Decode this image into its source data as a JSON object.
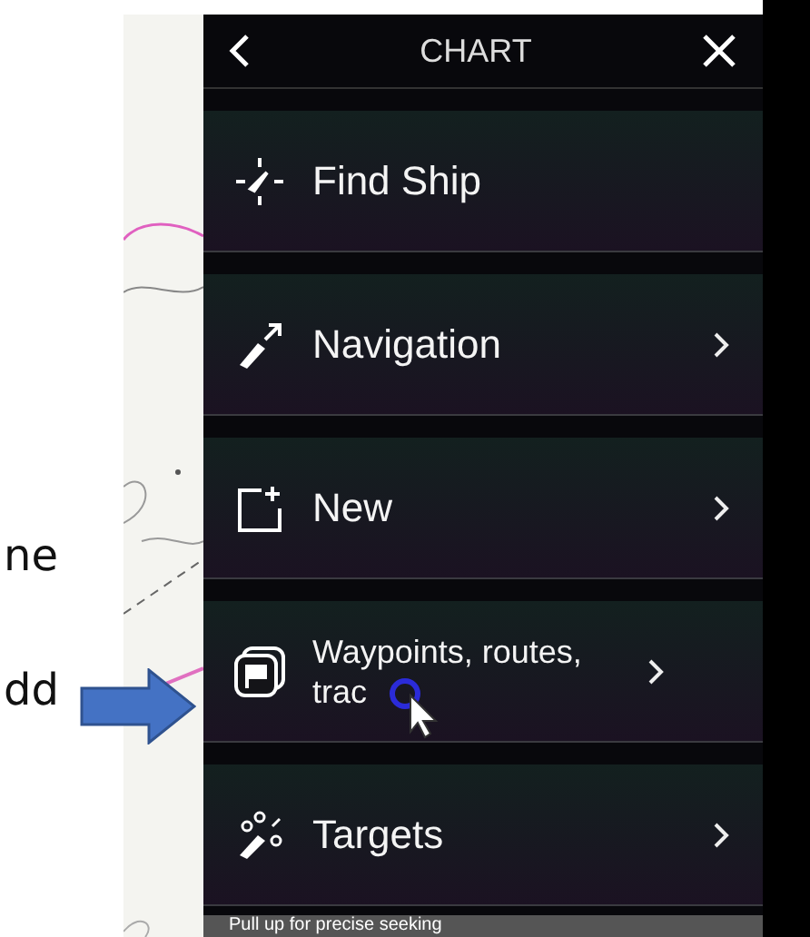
{
  "annotation": {
    "texts": [
      "ne",
      "dd"
    ]
  },
  "menu": {
    "title": "CHART",
    "items": [
      {
        "label": "Find Ship",
        "has_submenu": false
      },
      {
        "label": "Navigation",
        "has_submenu": true
      },
      {
        "label": "New",
        "has_submenu": true
      },
      {
        "label": "Waypoints, routes, trac",
        "has_submenu": true
      },
      {
        "label": "Targets",
        "has_submenu": true
      }
    ]
  },
  "video_hint": "Pull up for precise seeking"
}
